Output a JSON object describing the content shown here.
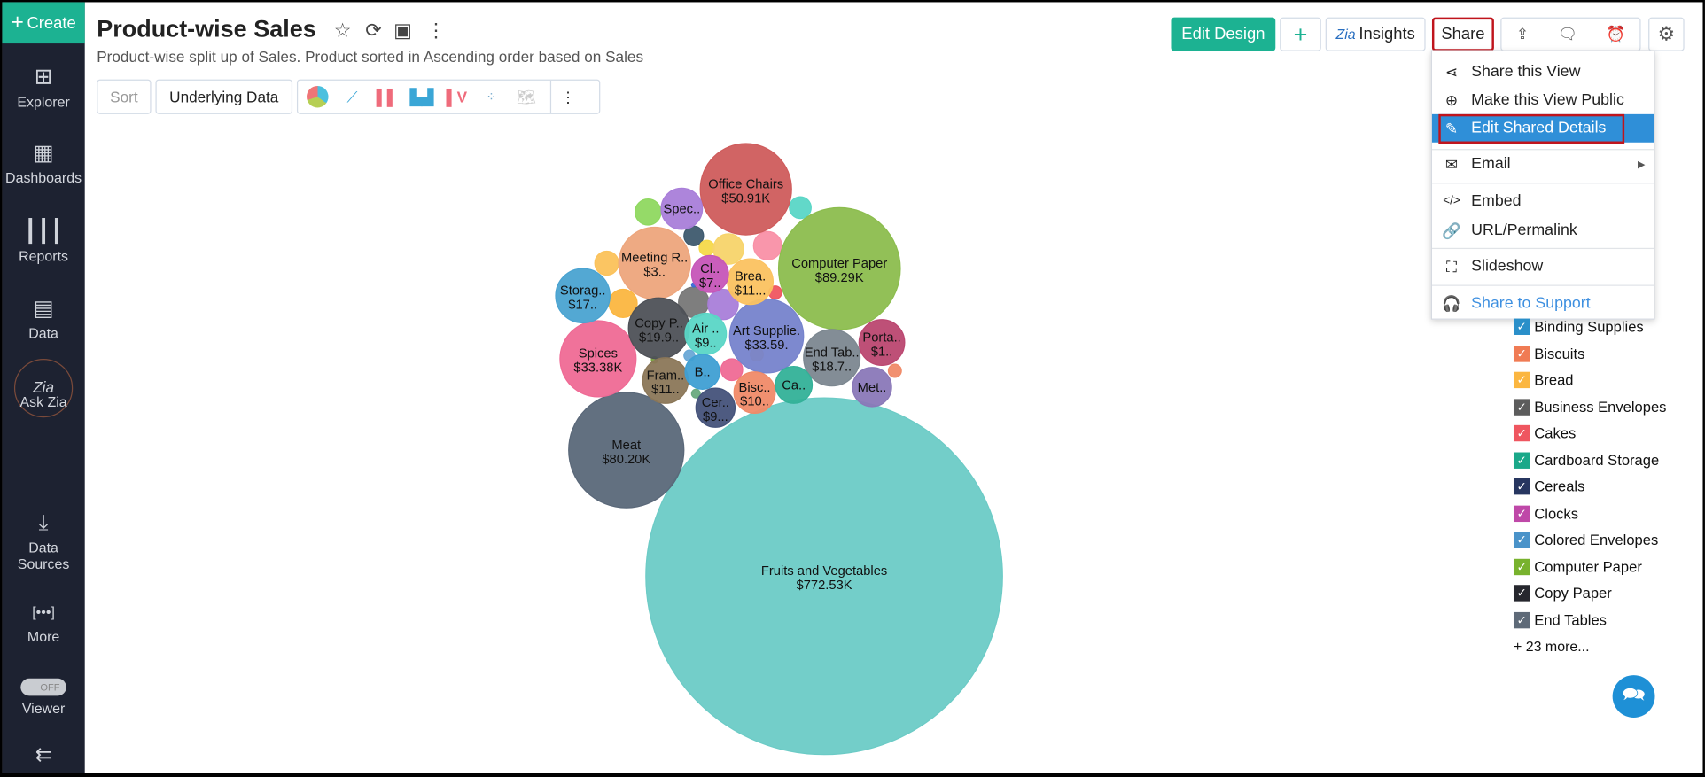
{
  "sidebar": {
    "create": "Create",
    "items": [
      {
        "label": "Explorer",
        "icon": "explorer-icon"
      },
      {
        "label": "Dashboards",
        "icon": "dashboards-icon"
      },
      {
        "label": "Reports",
        "icon": "reports-icon"
      },
      {
        "label": "Data",
        "icon": "table-icon"
      },
      {
        "label": "Ask Zia",
        "icon": "zia-icon"
      },
      {
        "label": "Data",
        "label2": "Sources",
        "icon": "data-sources-icon"
      },
      {
        "label": "More",
        "icon": "more-icon"
      },
      {
        "label": "Viewer",
        "icon": "toggle-icon",
        "toggle": "OFF"
      }
    ]
  },
  "header": {
    "title": "Product-wise Sales",
    "subtitle": "Product-wise split up of Sales. Product sorted in Ascending order based on Sales"
  },
  "toolbar": {
    "sort": "Sort",
    "underlying": "Underlying Data"
  },
  "actions": {
    "edit_design": "Edit Design",
    "insights": "Insights",
    "share": "Share"
  },
  "share_menu": [
    {
      "label": "Share this View",
      "icon": "share-icon"
    },
    {
      "label": "Make this View Public",
      "icon": "globe-icon"
    },
    {
      "label": "Edit Shared Details",
      "icon": "pencil-icon",
      "highlighted": true
    },
    {
      "label": "Email",
      "icon": "mail-icon",
      "submenu": true
    },
    {
      "label": "Embed",
      "icon": "code-icon"
    },
    {
      "label": "URL/Permalink",
      "icon": "link-icon"
    },
    {
      "label": "Slideshow",
      "icon": "slideshow-icon"
    },
    {
      "label": "Share to Support",
      "icon": "headset-icon"
    }
  ],
  "legend": {
    "items": [
      {
        "label": "Binding Supplies",
        "color": "#2a8fc9"
      },
      {
        "label": "Biscuits",
        "color": "#f07b54"
      },
      {
        "label": "Bread",
        "color": "#fbb640"
      },
      {
        "label": "Business Envelopes",
        "color": "#5c5c5c"
      },
      {
        "label": "Cakes",
        "color": "#ef5660"
      },
      {
        "label": "Cardboard Storage",
        "color": "#1aa889"
      },
      {
        "label": "Cereals",
        "color": "#273660"
      },
      {
        "label": "Clocks",
        "color": "#bf48a8"
      },
      {
        "label": "Colored Envelopes",
        "color": "#4a93c9"
      },
      {
        "label": "Computer Paper",
        "color": "#78b22d"
      },
      {
        "label": "Copy Paper",
        "color": "#26272e"
      },
      {
        "label": "End Tables",
        "color": "#5e6a78"
      }
    ],
    "more": "+ 23 more..."
  },
  "chart_data": {
    "type": "bubble",
    "title": "",
    "series": [
      {
        "label": "Fruits and Vegetables",
        "value": "$772.53K",
        "color": "#6ccbc6"
      },
      {
        "label": "Computer Paper",
        "value": "$89.29K",
        "color": "#8cbd4e"
      },
      {
        "label": "Meat",
        "value": "$80.20K",
        "color": "#5a6879"
      },
      {
        "label": "Office Chairs",
        "value": "$50.91K",
        "color": "#cf5c5c"
      },
      {
        "label": "Art Supplie.",
        "value": "$33.59.",
        "color": "#7683cc"
      },
      {
        "label": "Spices",
        "value": "$33.38K",
        "color": "#ef6a95"
      },
      {
        "label": "Meeting R..",
        "value": "$3..",
        "color": "#eda57c"
      },
      {
        "label": "Copy P..",
        "value": "$19.9..",
        "color": "#4e5157"
      },
      {
        "label": "End Tab..",
        "value": "$18.7..",
        "color": "#7c8790"
      },
      {
        "label": "Storag..",
        "value": "$17..",
        "color": "#4aa3d1"
      },
      {
        "label": "Fram..",
        "value": "$11..",
        "color": "#8b7758"
      },
      {
        "label": "Brea.",
        "value": "$11...",
        "color": "#fbc260"
      },
      {
        "label": "Porta..",
        "value": "$1..",
        "color": "#bb4770"
      },
      {
        "label": "Bisc..",
        "value": "$10..",
        "color": "#f08a68"
      },
      {
        "label": "Air ..",
        "value": "$9..",
        "color": "#5ad6c6"
      },
      {
        "label": "Cer..",
        "value": "$9...",
        "color": "#44527a"
      },
      {
        "label": "Cl..",
        "value": "$7..",
        "color": "#c655b8"
      },
      {
        "label": "Spec..",
        "value": "",
        "color": "#a97ed9"
      },
      {
        "label": "Met..",
        "value": "",
        "color": "#8a78b8"
      },
      {
        "label": "Ca..",
        "value": "",
        "color": "#33b198"
      },
      {
        "label": "B..",
        "value": "",
        "color": "#3f9fd3"
      }
    ]
  }
}
